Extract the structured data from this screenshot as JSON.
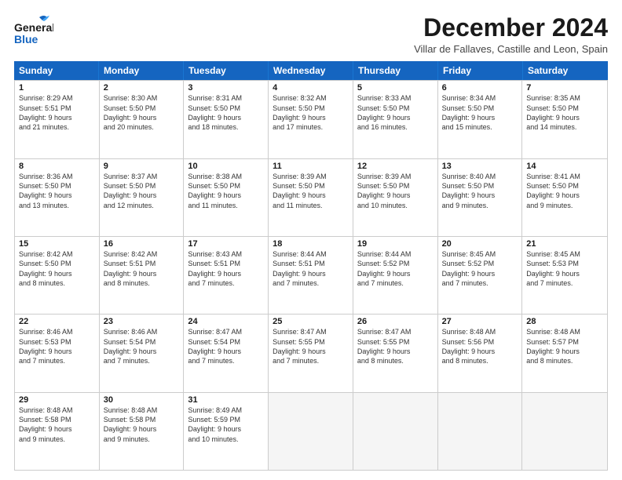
{
  "logo": {
    "general": "General",
    "blue": "Blue"
  },
  "header": {
    "month": "December 2024",
    "location": "Villar de Fallaves, Castille and Leon, Spain"
  },
  "weekdays": [
    "Sunday",
    "Monday",
    "Tuesday",
    "Wednesday",
    "Thursday",
    "Friday",
    "Saturday"
  ],
  "weeks": [
    [
      {
        "day": "1",
        "text": "Sunrise: 8:29 AM\nSunset: 5:51 PM\nDaylight: 9 hours\nand 21 minutes."
      },
      {
        "day": "2",
        "text": "Sunrise: 8:30 AM\nSunset: 5:50 PM\nDaylight: 9 hours\nand 20 minutes."
      },
      {
        "day": "3",
        "text": "Sunrise: 8:31 AM\nSunset: 5:50 PM\nDaylight: 9 hours\nand 18 minutes."
      },
      {
        "day": "4",
        "text": "Sunrise: 8:32 AM\nSunset: 5:50 PM\nDaylight: 9 hours\nand 17 minutes."
      },
      {
        "day": "5",
        "text": "Sunrise: 8:33 AM\nSunset: 5:50 PM\nDaylight: 9 hours\nand 16 minutes."
      },
      {
        "day": "6",
        "text": "Sunrise: 8:34 AM\nSunset: 5:50 PM\nDaylight: 9 hours\nand 15 minutes."
      },
      {
        "day": "7",
        "text": "Sunrise: 8:35 AM\nSunset: 5:50 PM\nDaylight: 9 hours\nand 14 minutes."
      }
    ],
    [
      {
        "day": "8",
        "text": "Sunrise: 8:36 AM\nSunset: 5:50 PM\nDaylight: 9 hours\nand 13 minutes."
      },
      {
        "day": "9",
        "text": "Sunrise: 8:37 AM\nSunset: 5:50 PM\nDaylight: 9 hours\nand 12 minutes."
      },
      {
        "day": "10",
        "text": "Sunrise: 8:38 AM\nSunset: 5:50 PM\nDaylight: 9 hours\nand 11 minutes."
      },
      {
        "day": "11",
        "text": "Sunrise: 8:39 AM\nSunset: 5:50 PM\nDaylight: 9 hours\nand 11 minutes."
      },
      {
        "day": "12",
        "text": "Sunrise: 8:39 AM\nSunset: 5:50 PM\nDaylight: 9 hours\nand 10 minutes."
      },
      {
        "day": "13",
        "text": "Sunrise: 8:40 AM\nSunset: 5:50 PM\nDaylight: 9 hours\nand 9 minutes."
      },
      {
        "day": "14",
        "text": "Sunrise: 8:41 AM\nSunset: 5:50 PM\nDaylight: 9 hours\nand 9 minutes."
      }
    ],
    [
      {
        "day": "15",
        "text": "Sunrise: 8:42 AM\nSunset: 5:50 PM\nDaylight: 9 hours\nand 8 minutes."
      },
      {
        "day": "16",
        "text": "Sunrise: 8:42 AM\nSunset: 5:51 PM\nDaylight: 9 hours\nand 8 minutes."
      },
      {
        "day": "17",
        "text": "Sunrise: 8:43 AM\nSunset: 5:51 PM\nDaylight: 9 hours\nand 7 minutes."
      },
      {
        "day": "18",
        "text": "Sunrise: 8:44 AM\nSunset: 5:51 PM\nDaylight: 9 hours\nand 7 minutes."
      },
      {
        "day": "19",
        "text": "Sunrise: 8:44 AM\nSunset: 5:52 PM\nDaylight: 9 hours\nand 7 minutes."
      },
      {
        "day": "20",
        "text": "Sunrise: 8:45 AM\nSunset: 5:52 PM\nDaylight: 9 hours\nand 7 minutes."
      },
      {
        "day": "21",
        "text": "Sunrise: 8:45 AM\nSunset: 5:53 PM\nDaylight: 9 hours\nand 7 minutes."
      }
    ],
    [
      {
        "day": "22",
        "text": "Sunrise: 8:46 AM\nSunset: 5:53 PM\nDaylight: 9 hours\nand 7 minutes."
      },
      {
        "day": "23",
        "text": "Sunrise: 8:46 AM\nSunset: 5:54 PM\nDaylight: 9 hours\nand 7 minutes."
      },
      {
        "day": "24",
        "text": "Sunrise: 8:47 AM\nSunset: 5:54 PM\nDaylight: 9 hours\nand 7 minutes."
      },
      {
        "day": "25",
        "text": "Sunrise: 8:47 AM\nSunset: 5:55 PM\nDaylight: 9 hours\nand 7 minutes."
      },
      {
        "day": "26",
        "text": "Sunrise: 8:47 AM\nSunset: 5:55 PM\nDaylight: 9 hours\nand 8 minutes."
      },
      {
        "day": "27",
        "text": "Sunrise: 8:48 AM\nSunset: 5:56 PM\nDaylight: 9 hours\nand 8 minutes."
      },
      {
        "day": "28",
        "text": "Sunrise: 8:48 AM\nSunset: 5:57 PM\nDaylight: 9 hours\nand 8 minutes."
      }
    ],
    [
      {
        "day": "29",
        "text": "Sunrise: 8:48 AM\nSunset: 5:58 PM\nDaylight: 9 hours\nand 9 minutes."
      },
      {
        "day": "30",
        "text": "Sunrise: 8:48 AM\nSunset: 5:58 PM\nDaylight: 9 hours\nand 9 minutes."
      },
      {
        "day": "31",
        "text": "Sunrise: 8:49 AM\nSunset: 5:59 PM\nDaylight: 9 hours\nand 10 minutes."
      },
      {
        "day": "",
        "text": ""
      },
      {
        "day": "",
        "text": ""
      },
      {
        "day": "",
        "text": ""
      },
      {
        "day": "",
        "text": ""
      }
    ]
  ]
}
